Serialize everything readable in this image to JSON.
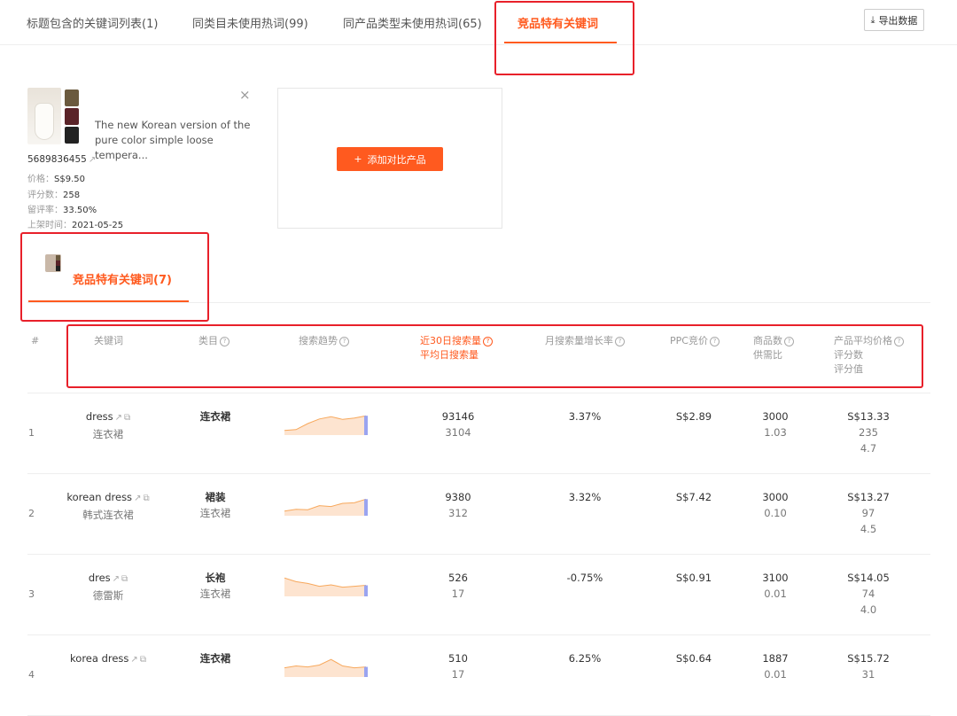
{
  "tabs": [
    {
      "label": "标题包含的关键词列表(1)"
    },
    {
      "label": "同类目未使用热词(99)"
    },
    {
      "label": "同产品类型未使用热词(65)"
    },
    {
      "label": "竞品特有关键词"
    }
  ],
  "export_label": "导出数据",
  "product": {
    "title": "The new Korean version of the pure color simple loose tempera...",
    "sku": "5689836455",
    "price_label": "价格：",
    "price": "S$9.50",
    "reviews_label": "评分数：",
    "reviews": "258",
    "rate_label": "留评率：",
    "rate": "33.50%",
    "date_label": "上架时间：",
    "date": "2021-05-25",
    "swatch_colors": [
      "#6b5a3e",
      "#5a2328",
      "#222222"
    ]
  },
  "add_compare_label": "添加对比产品",
  "sub_tab_label": "竞品特有关键词(7)",
  "headers": {
    "num": "#",
    "keyword": "关键词",
    "category": "类目",
    "trend": "搜索趋势",
    "search30": "近30日搜索量",
    "dailysearch": "平均日搜索量",
    "growth": "月搜索量增长率",
    "ppc": "PPC竞价",
    "products": "商品数",
    "supply": "供需比",
    "avgprice": "产品平均价格",
    "ratecount": "评分数",
    "ratevalue": "评分值"
  },
  "rows": [
    {
      "num": "1",
      "kw": "dress",
      "kw_cn": "连衣裙",
      "cat1": "连衣裙",
      "cat2": "",
      "search": "93146",
      "daily": "3104",
      "growth": "3.37%",
      "ppc": "S$2.89",
      "products": "3000",
      "supply": "1.03",
      "price": "S$13.33",
      "rcount": "235",
      "rvalue": "4.7",
      "trend": [
        30,
        32,
        45,
        55,
        60,
        54,
        57,
        62
      ]
    },
    {
      "num": "2",
      "kw": "korean dress",
      "kw_cn": "韩式连衣裙",
      "cat1": "裙装",
      "cat2": "连衣裙",
      "search": "9380",
      "daily": "312",
      "growth": "3.32%",
      "ppc": "S$7.42",
      "products": "3000",
      "supply": "0.10",
      "price": "S$13.27",
      "rcount": "97",
      "rvalue": "4.5",
      "trend": [
        30,
        34,
        33,
        42,
        40,
        47,
        48,
        56
      ]
    },
    {
      "num": "3",
      "kw": "dres",
      "kw_cn": "德雷斯",
      "cat1": "长袍",
      "cat2": "连衣裙",
      "search": "526",
      "daily": "17",
      "growth": "-0.75%",
      "ppc": "S$0.91",
      "products": "3100",
      "supply": "0.01",
      "price": "S$14.05",
      "rcount": "74",
      "rvalue": "4.0",
      "trend": [
        60,
        52,
        48,
        42,
        45,
        40,
        42,
        44
      ]
    },
    {
      "num": "4",
      "kw": "korea dress",
      "kw_cn": "",
      "cat1": "连衣裙",
      "cat2": "",
      "search": "510",
      "daily": "17",
      "growth": "6.25%",
      "ppc": "S$0.64",
      "products": "1887",
      "supply": "0.01",
      "price": "S$15.72",
      "rcount": "31",
      "rvalue": "",
      "trend": [
        40,
        44,
        42,
        46,
        58,
        44,
        40,
        42
      ]
    }
  ]
}
